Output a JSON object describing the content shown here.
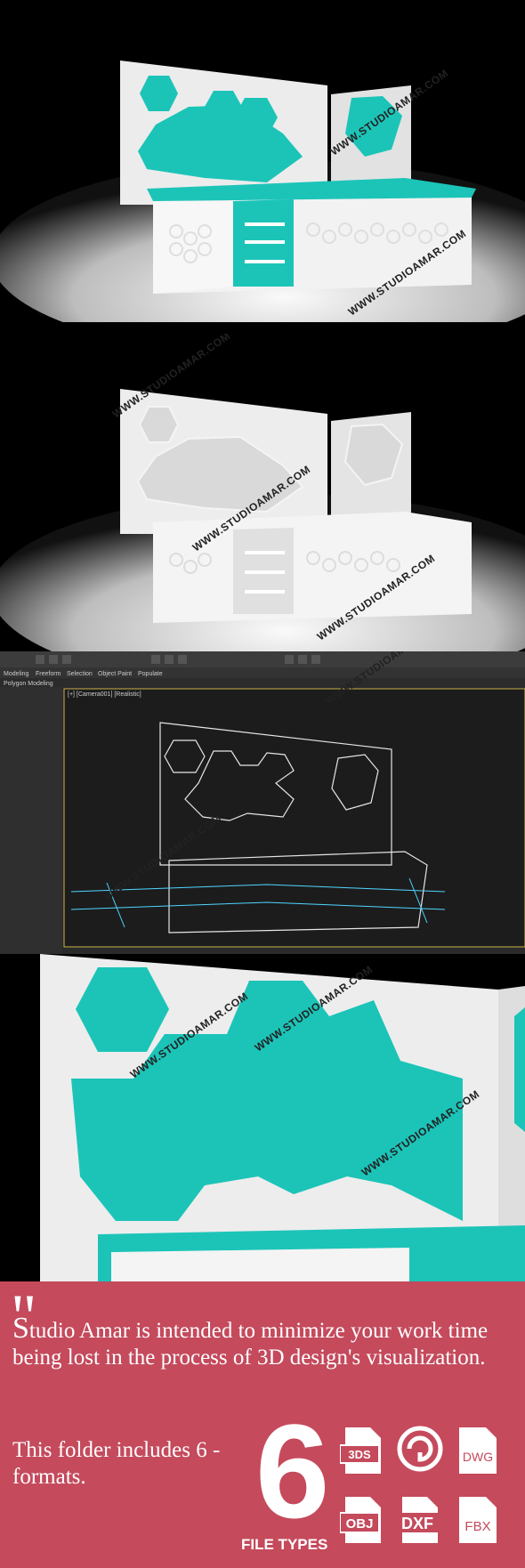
{
  "watermark": "WWW.STUDIOAMAR.COM",
  "toolbar": {
    "tabs": [
      "Modeling",
      "Freeform",
      "Selection",
      "Object Paint",
      "Populate"
    ],
    "mode_label": "Polygon Modeling",
    "viewport_label": "[+] [Camera001] [Realistic]"
  },
  "colors": {
    "accent": "#1cc4b8",
    "panel_bg": "#c44a5c"
  },
  "promo": {
    "quote_mark": "\"",
    "intro_first_letter": "S",
    "intro_rest": "tudio Amar is intended to minimize your work time being lost in the process of 3D design's visualization.",
    "includes_text": "This folder includes 6 - formats.",
    "big_number": "6",
    "file_types_label": "FILE TYPES",
    "formats": [
      "3DS",
      "3ds Max",
      "DWG",
      "OBJ",
      "DXF",
      "FBX"
    ]
  }
}
